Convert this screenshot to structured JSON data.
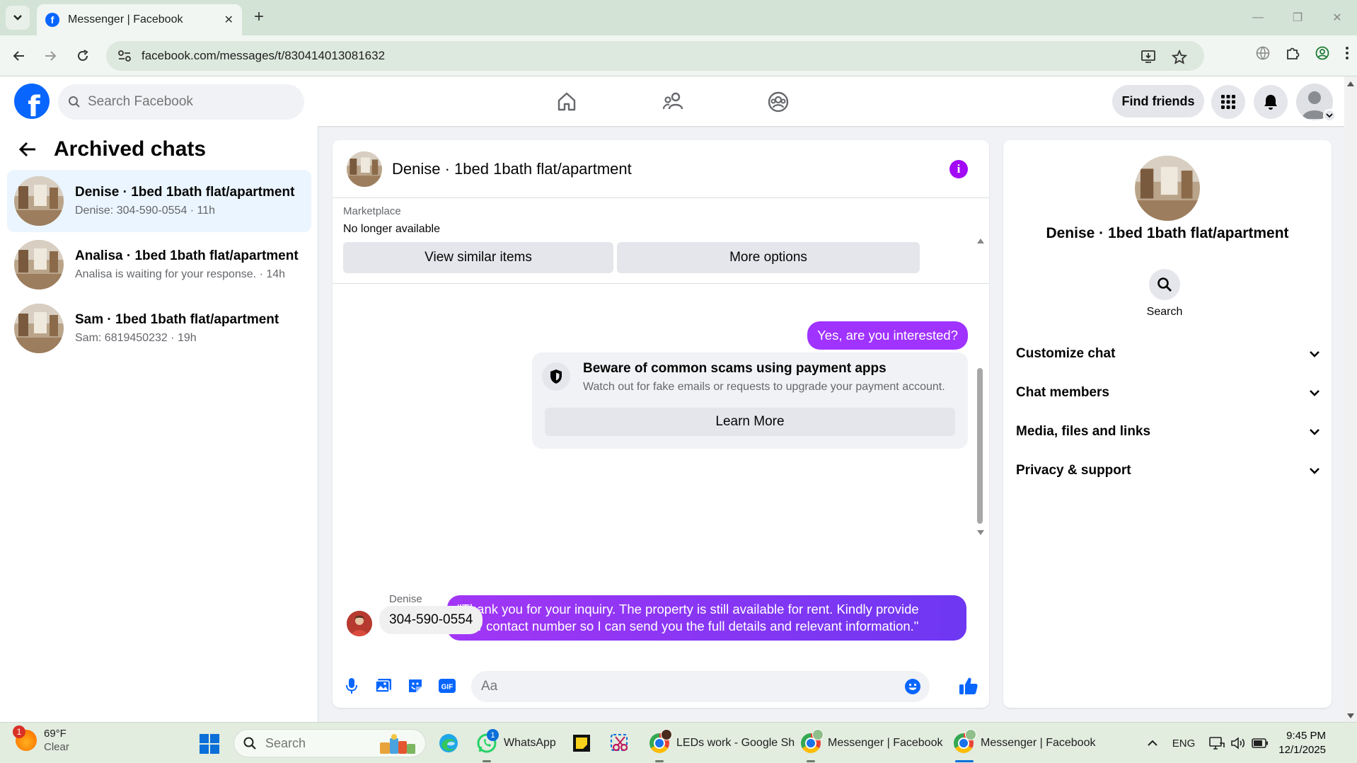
{
  "browser": {
    "tab_title": "Messenger | Facebook",
    "url": "facebook.com/messages/t/830414013081632"
  },
  "fb_header": {
    "search_placeholder": "Search Facebook",
    "find_friends": "Find friends"
  },
  "sidebar": {
    "title": "Archived chats",
    "chats": [
      {
        "name": "Denise · 1bed 1bath flat/apartment",
        "preview": "Denise: 304-590-0554 · 11h",
        "active": true
      },
      {
        "name": "Analisa · 1bed 1bath flat/apartment",
        "preview": "Analisa is waiting for your response. · 14h",
        "active": false
      },
      {
        "name": "Sam · 1bed 1bath flat/apartment",
        "preview": "Sam: 6819450232 · 19h",
        "active": false
      }
    ]
  },
  "conversation": {
    "title": "Denise · 1bed 1bath flat/apartment",
    "marketplace_label": "Marketplace",
    "marketplace_status": "No longer available",
    "view_similar": "View similar items",
    "more_options": "More options",
    "messages": {
      "out_1": "Yes, are you interested?",
      "scam_title": "Beware of common scams using payment apps",
      "scam_text": "Watch out for fake emails or requests to upgrade your payment account.",
      "learn_more": "Learn More",
      "out_2_line1": "\"Thank you for your inquiry. The property is still available for rent. Kindly provide",
      "out_2_line2": "your contact number so I can send you the full details and relevant information.\"",
      "sender": "Denise",
      "in_1": "304-590-0554"
    },
    "composer_placeholder": "Aa"
  },
  "info_panel": {
    "name": "Denise · 1bed 1bath flat/apartment",
    "search_label": "Search",
    "sections": [
      "Customize chat",
      "Chat members",
      "Media, files and links",
      "Privacy & support"
    ]
  },
  "taskbar": {
    "weather_temp": "69°F",
    "weather_cond": "Clear",
    "weather_badge": "1",
    "search_placeholder": "Search",
    "apps": {
      "whatsapp": "WhatsApp",
      "whatsapp_badge": "1",
      "sheets": "LEDs work - Google Sh",
      "messenger1": "Messenger | Facebook",
      "messenger2": "Messenger | Facebook"
    },
    "lang": "ENG",
    "time": "9:45 PM",
    "date": "12/1/2025"
  },
  "colors": {
    "fb_blue": "#0866ff",
    "bubble_purple": "#a033ff",
    "info_purple": "#a20af5"
  }
}
